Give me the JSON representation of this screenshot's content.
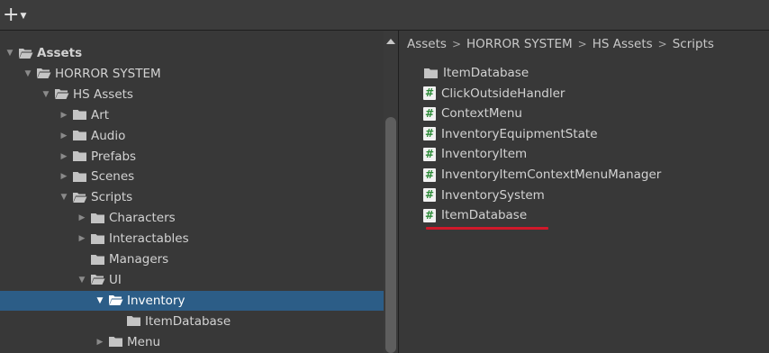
{
  "toolbar": {
    "add_label": "+",
    "dropdown_caret": "▼"
  },
  "tree": [
    {
      "label": "Assets",
      "depth": 0,
      "arrow": "expanded",
      "icon": "folder-open-icon",
      "bold": true
    },
    {
      "label": "HORROR SYSTEM",
      "depth": 1,
      "arrow": "expanded",
      "icon": "folder-open-icon"
    },
    {
      "label": "HS Assets",
      "depth": 2,
      "arrow": "expanded",
      "icon": "folder-open-icon"
    },
    {
      "label": "Art",
      "depth": 3,
      "arrow": "collapsed",
      "icon": "folder-icon"
    },
    {
      "label": "Audio",
      "depth": 3,
      "arrow": "collapsed",
      "icon": "folder-icon"
    },
    {
      "label": "Prefabs",
      "depth": 3,
      "arrow": "collapsed",
      "icon": "folder-icon"
    },
    {
      "label": "Scenes",
      "depth": 3,
      "arrow": "collapsed",
      "icon": "folder-icon"
    },
    {
      "label": "Scripts",
      "depth": 3,
      "arrow": "expanded",
      "icon": "folder-open-icon"
    },
    {
      "label": "Characters",
      "depth": 4,
      "arrow": "collapsed",
      "icon": "folder-icon"
    },
    {
      "label": "Interactables",
      "depth": 4,
      "arrow": "collapsed",
      "icon": "folder-icon"
    },
    {
      "label": "Managers",
      "depth": 4,
      "arrow": "none",
      "icon": "folder-icon"
    },
    {
      "label": "UI",
      "depth": 4,
      "arrow": "expanded",
      "icon": "folder-open-icon"
    },
    {
      "label": "Inventory",
      "depth": 5,
      "arrow": "expanded",
      "icon": "folder-open-icon",
      "selected": true
    },
    {
      "label": "ItemDatabase",
      "depth": 6,
      "arrow": "none",
      "icon": "folder-icon"
    },
    {
      "label": "Menu",
      "depth": 5,
      "arrow": "collapsed",
      "icon": "folder-icon"
    }
  ],
  "breadcrumb": [
    "Assets",
    "HORROR SYSTEM",
    "HS Assets",
    "Scripts"
  ],
  "breadcrumb_separator": ">",
  "files": [
    {
      "label": "ItemDatabase",
      "icon": "folder-icon"
    },
    {
      "label": "ClickOutsideHandler",
      "icon": "csharp-script-icon"
    },
    {
      "label": "ContextMenu",
      "icon": "csharp-script-icon"
    },
    {
      "label": "InventoryEquipmentState",
      "icon": "csharp-script-icon"
    },
    {
      "label": "InventoryItem",
      "icon": "csharp-script-icon"
    },
    {
      "label": "InventoryItemContextMenuManager",
      "icon": "csharp-script-icon"
    },
    {
      "label": "InventorySystem",
      "icon": "csharp-script-icon"
    },
    {
      "label": "ItemDatabase",
      "icon": "csharp-script-icon",
      "underlined": true
    }
  ],
  "script_glyph": "#",
  "colors": {
    "background": "#383838",
    "selection": "#2c5d87",
    "folder": "#c4c4c4",
    "script_hash": "#2a8a36",
    "underline": "#d0182a"
  }
}
